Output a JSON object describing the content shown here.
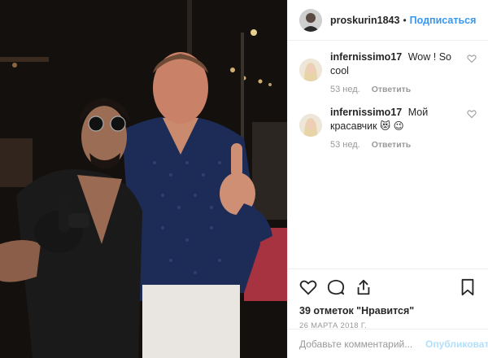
{
  "post": {
    "author": {
      "username": "proskurin1843",
      "avatar_icon": "user-avatar"
    },
    "header": {
      "separator": "•",
      "follow_label": "Подписаться"
    },
    "comments": [
      {
        "username": "infernissimo17",
        "text": "Wow ! So cool",
        "time": "53 нед.",
        "reply_label": "Ответить"
      },
      {
        "username": "infernissimo17",
        "text": "Мой красавчик 😻 😉",
        "time": "53 нед.",
        "reply_label": "Ответить"
      }
    ],
    "likes_label": "39 отметок \"Нравится\"",
    "date": "26 МАРТА 2018 Г.",
    "add_comment": {
      "placeholder": "Добавьте комментарий...",
      "publish_label": "Опубликовать"
    },
    "colors": {
      "link": "#3897f0",
      "publish_disabled": "#b2dffc",
      "muted": "#999999",
      "text": "#262626"
    }
  }
}
